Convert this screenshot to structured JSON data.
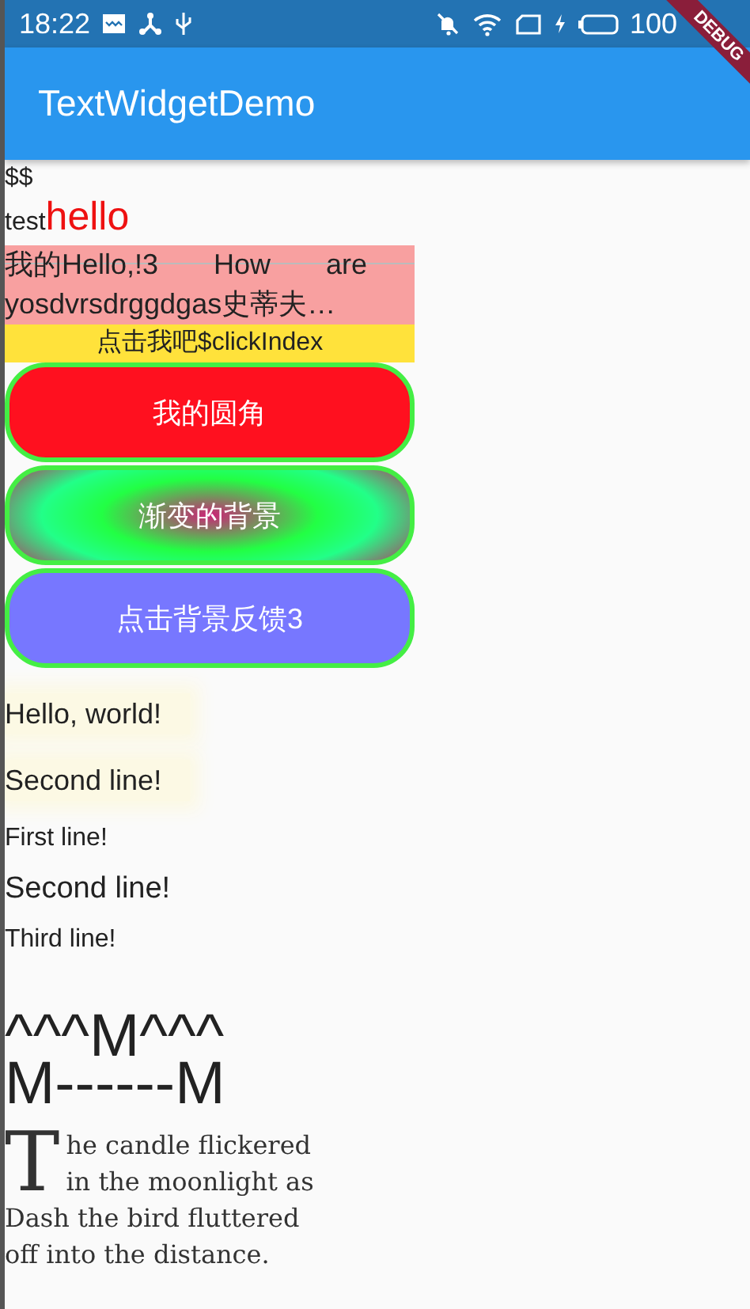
{
  "status_bar": {
    "time": "18:22",
    "battery": "100"
  },
  "debug_banner": {
    "label": "DEBUG"
  },
  "app_bar": {
    "title": "TextWidgetDemo"
  },
  "body": {
    "dollar_text": "$$",
    "mixed_text": [
      {
        "text": "test",
        "kind": "plain"
      },
      {
        "text": "hello",
        "kind": "accent"
      }
    ],
    "justified_lines": [
      "我的Hello,!3 How are",
      "yosdvrsdrggdgas史蒂夫…"
    ],
    "click_bar": "点击我吧$clickIndex",
    "buttons": [
      {
        "label": "我的圆角",
        "kind": "solid"
      },
      {
        "label": "渐变的背景",
        "kind": "gradient"
      },
      {
        "label": "点击背景反馈3",
        "kind": "feedback"
      }
    ],
    "shadow_lines": [
      "Hello, world!",
      "Second line!"
    ],
    "plain_lines": [
      {
        "text": "First line!",
        "kind": "normal"
      },
      {
        "text": "Second line!",
        "kind": "large"
      },
      {
        "text": "Third line!",
        "kind": "normal"
      }
    ],
    "strut_lines": [
      "^^^M^^^",
      "M------M"
    ],
    "drop_cap": {
      "letter": "T",
      "text": "he candle flickered in the moonlight as Dash the bird fluttered off into the distance."
    }
  }
}
